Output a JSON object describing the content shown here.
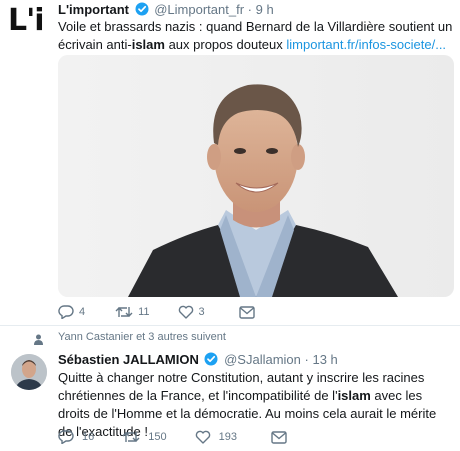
{
  "tweet1": {
    "name": "L'important",
    "handle": "@Limportant_fr",
    "dot": "·",
    "time": "9 h",
    "text_before": "Voile et brassards nazis : quand Bernard de la Villardière soutient un écrivain anti-",
    "text_bold": "islam",
    "text_after": " aux propos douteux ",
    "link": "limportant.fr/infos-societe/...",
    "replies": "4",
    "retweets": "11",
    "likes": "3"
  },
  "tweet2": {
    "social_context": "Yann Castanier et 3 autres suivent",
    "name": "Sébastien JALLAMION",
    "handle": "@SJallamion",
    "dot": "·",
    "time": "13 h",
    "text_before": "Quitte à changer notre Constitution, autant y inscrire les racines chrétiennes de la France, et l'incompatibilité de l'",
    "text_bold": "islam",
    "text_after": " avec les droits de l'Homme et la démocratie. Au moins cela aurait le mérite de l'exactitude !",
    "replies": "16",
    "retweets": "150",
    "likes": "193"
  },
  "colors": {
    "verified": "#1da1f2",
    "link": "#1b95e0",
    "muted": "#657786",
    "text": "#14171a"
  },
  "icons": [
    "verified-badge-icon",
    "reply-icon",
    "retweet-icon",
    "like-icon",
    "message-icon",
    "person-icon"
  ]
}
